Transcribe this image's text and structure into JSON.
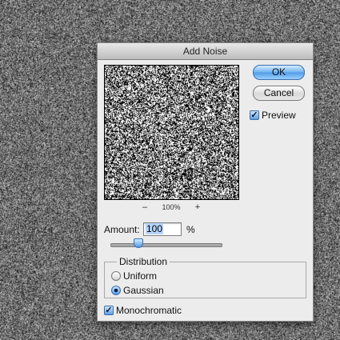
{
  "dialog": {
    "title": "Add Noise",
    "ok_label": "OK",
    "cancel_label": "Cancel",
    "preview_label": "Preview",
    "preview_checked": true
  },
  "preview": {
    "zoom_out": "–",
    "zoom_level": "100%",
    "zoom_in": "+"
  },
  "amount": {
    "label": "Amount:",
    "value": "100",
    "unit": "%",
    "slider_fraction": 0.25
  },
  "distribution": {
    "legend": "Distribution",
    "options": [
      {
        "label": "Uniform",
        "selected": false
      },
      {
        "label": "Gaussian",
        "selected": true
      }
    ]
  },
  "monochromatic": {
    "label": "Monochromatic",
    "checked": true
  },
  "colors": {
    "accent": "#4f9be6",
    "dialog_bg": "#ececec"
  }
}
